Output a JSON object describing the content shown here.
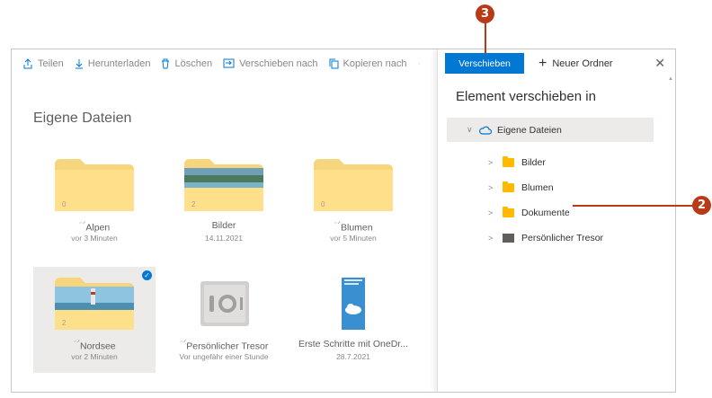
{
  "toolbar": {
    "share": "Teilen",
    "download": "Herunterladen",
    "delete": "Löschen",
    "move_to": "Verschieben nach",
    "copy_to": "Kopieren nach"
  },
  "main": {
    "title": "Eigene Dateien",
    "items": [
      {
        "name": "Alpen",
        "date": "vor 3 Minuten",
        "count": "0"
      },
      {
        "name": "Bilder",
        "date": "14.11.2021",
        "count": "2"
      },
      {
        "name": "Blumen",
        "date": "vor 5 Minuten",
        "count": "0"
      },
      {
        "name": "Nordsee",
        "date": "vor 2 Minuten",
        "count": "2"
      },
      {
        "name": "Persönlicher Tresor",
        "date": "Vor ungefähr einer Stunde"
      },
      {
        "name": "Erste Schritte mit OneDr...",
        "date": "28.7.2021"
      }
    ]
  },
  "panel": {
    "move_button": "Verschieben",
    "new_folder": "Neuer Ordner",
    "close": "✕",
    "title": "Element verschieben in",
    "root": "Eigene Dateien",
    "folders": [
      "Bilder",
      "Blumen",
      "Dokumente",
      "Persönlicher Tresor"
    ]
  },
  "callouts": {
    "c2": "2",
    "c3": "3"
  },
  "colors": {
    "accent": "#0078d4",
    "callout": "#b83a16",
    "folder": "#ffb900"
  }
}
